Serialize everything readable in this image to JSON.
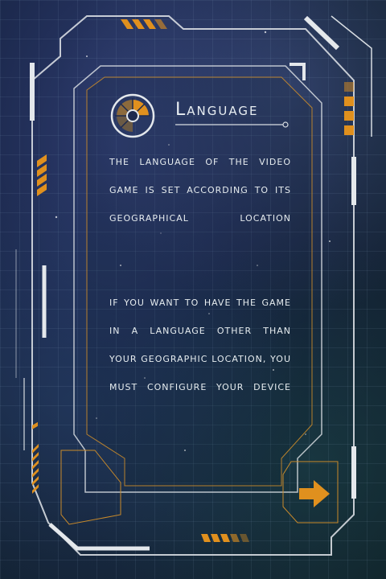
{
  "panel": {
    "title": "Language",
    "paragraph1": "The language of the video game is set according to its geographical location",
    "paragraph2": "If you want to have the game in a language other than your geographic location, you must configure your device"
  },
  "icons": {
    "language": "language-gauge-icon",
    "next": "arrow-right-icon"
  },
  "colors": {
    "accent": "#e0901e",
    "frame": "#d8dde2",
    "inner_border": "#c98a2a"
  }
}
